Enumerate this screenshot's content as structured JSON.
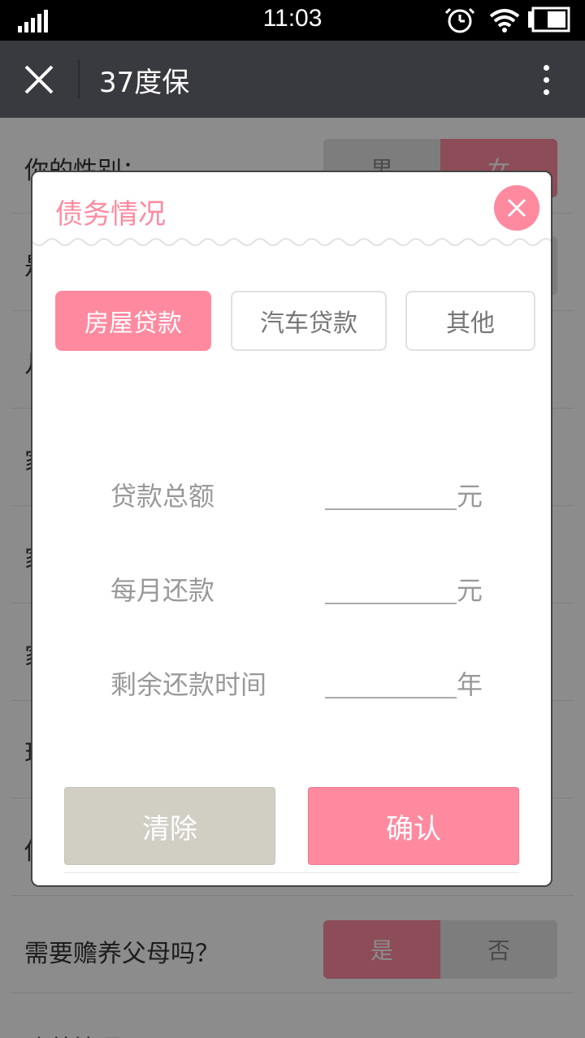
{
  "status_bar": {
    "time": "11:03"
  },
  "nav": {
    "title": "37度保"
  },
  "background": {
    "gender_label": "你的性别：",
    "gender_options": [
      "男",
      "女"
    ],
    "row_partial_1": "是",
    "row_partial_2": "几",
    "row_partial_3": "家",
    "row_partial_4": "家",
    "row_partial_5": "家",
    "row_partial_6": "现",
    "row_partial_7": "你",
    "parents_label": "需要赡养父母吗？",
    "parents_options": [
      "是",
      "否"
    ],
    "bottom_partial": "赡养情况",
    "dots": "•••"
  },
  "modal": {
    "title": "债务情况",
    "tabs": [
      "房屋贷款",
      "汽车贷款",
      "其他"
    ],
    "fields": [
      {
        "label": "贷款总额",
        "unit": "元"
      },
      {
        "label": "每月还款",
        "unit": "元"
      },
      {
        "label": "剩余还款时间",
        "unit": "年"
      }
    ],
    "clear_label": "清除",
    "confirm_label": "确认"
  },
  "colors": {
    "accent": "#ff8aa0",
    "nav": "#393a3f",
    "clear": "#d1cec4"
  },
  "icons": [
    "signal-icon",
    "alarm-icon",
    "wifi-icon",
    "battery-icon",
    "close-icon",
    "more-icon",
    "modal-close-icon"
  ]
}
